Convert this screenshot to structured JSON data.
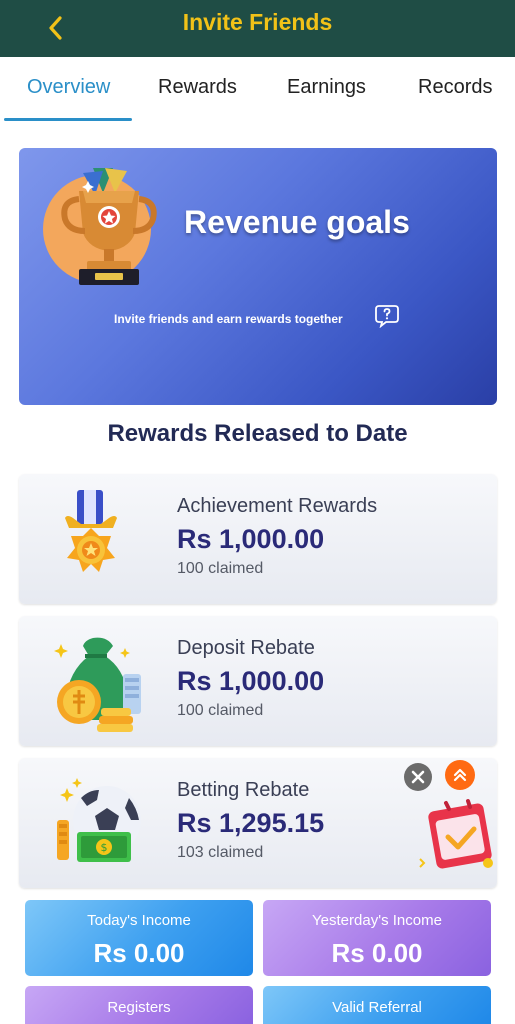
{
  "header": {
    "title": "Invite Friends",
    "back_icon": "chevron-left-icon"
  },
  "tabs": [
    {
      "label": "Overview",
      "active": true
    },
    {
      "label": "Rewards",
      "active": false
    },
    {
      "label": "Earnings",
      "active": false
    },
    {
      "label": "Records",
      "active": false
    }
  ],
  "banner": {
    "title": "Revenue goals",
    "subtitle": "Invite friends and earn rewards together",
    "help_icon": "question-icon"
  },
  "section_title": "Rewards Released to Date",
  "rewards": [
    {
      "name": "Achievement Rewards",
      "amount": "Rs 1,000.00",
      "claimed": "100 claimed",
      "icon": "medal-icon"
    },
    {
      "name": "Deposit Rebate",
      "amount": "Rs 1,000.00",
      "claimed": "100 claimed",
      "icon": "money-bag-icon"
    },
    {
      "name": "Betting Rebate",
      "amount": "Rs 1,295.15",
      "claimed": "103 claimed",
      "icon": "soccer-ball-icon"
    }
  ],
  "floating": {
    "close_icon": "close-icon",
    "up_icon": "double-chevron-up-icon",
    "promo_icon": "calendar-gift-icon"
  },
  "stats": {
    "today": {
      "label": "Today's Income",
      "value": "Rs 0.00"
    },
    "yesterday": {
      "label": "Yesterday's Income",
      "value": "Rs 0.00"
    },
    "registers": {
      "label": "Registers"
    },
    "valid_referral": {
      "label": "Valid Referral"
    }
  },
  "colors": {
    "header_bg": "#1f4d45",
    "header_title": "#f2c218",
    "tab_active": "#2a8fc8",
    "amount_text": "#2a2a78"
  }
}
